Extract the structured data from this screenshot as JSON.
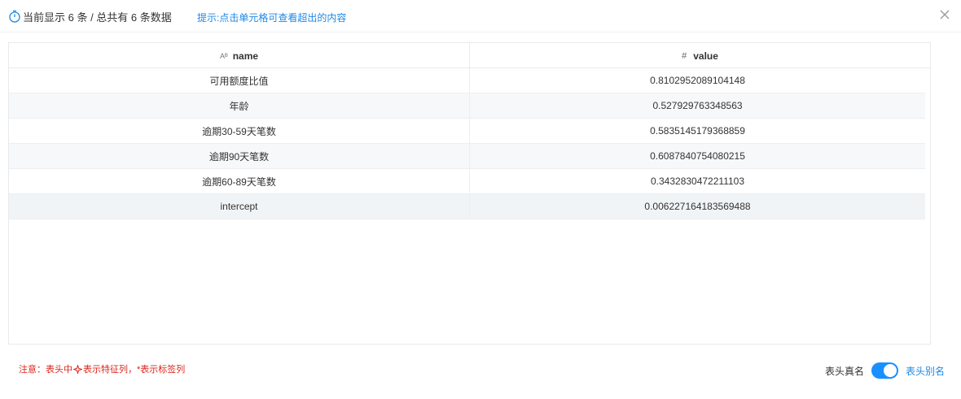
{
  "header": {
    "summary": "当前显示 6 条 / 总共有 6 条数据",
    "hint": "提示:点击单元格可查看超出的内容"
  },
  "table": {
    "columns": [
      {
        "icon": "text-type-icon",
        "icon_glyph": "Aᴮ",
        "label": "name"
      },
      {
        "icon": "number-type-icon",
        "icon_glyph": "#",
        "label": "value"
      }
    ],
    "rows": [
      {
        "name": "可用额度比值",
        "value": "0.8102952089104148"
      },
      {
        "name": "年龄",
        "value": "0.527929763348563"
      },
      {
        "name": "逾期30-59天笔数",
        "value": "0.5835145179368859"
      },
      {
        "name": "逾期90天笔数",
        "value": "0.6087840754080215"
      },
      {
        "name": "逾期60-89天笔数",
        "value": "0.3432830472211103"
      },
      {
        "name": "intercept",
        "value": "0.006227164183569488"
      }
    ]
  },
  "footer": {
    "note_prefix": "注意：表头中",
    "note_suffix": "表示特征列，*表示标签列",
    "toggle_off_label": "表头真名",
    "toggle_on_label": "表头别名",
    "toggle_state": "on",
    "accent_color": "#1890ff",
    "note_color": "#d9251d"
  }
}
